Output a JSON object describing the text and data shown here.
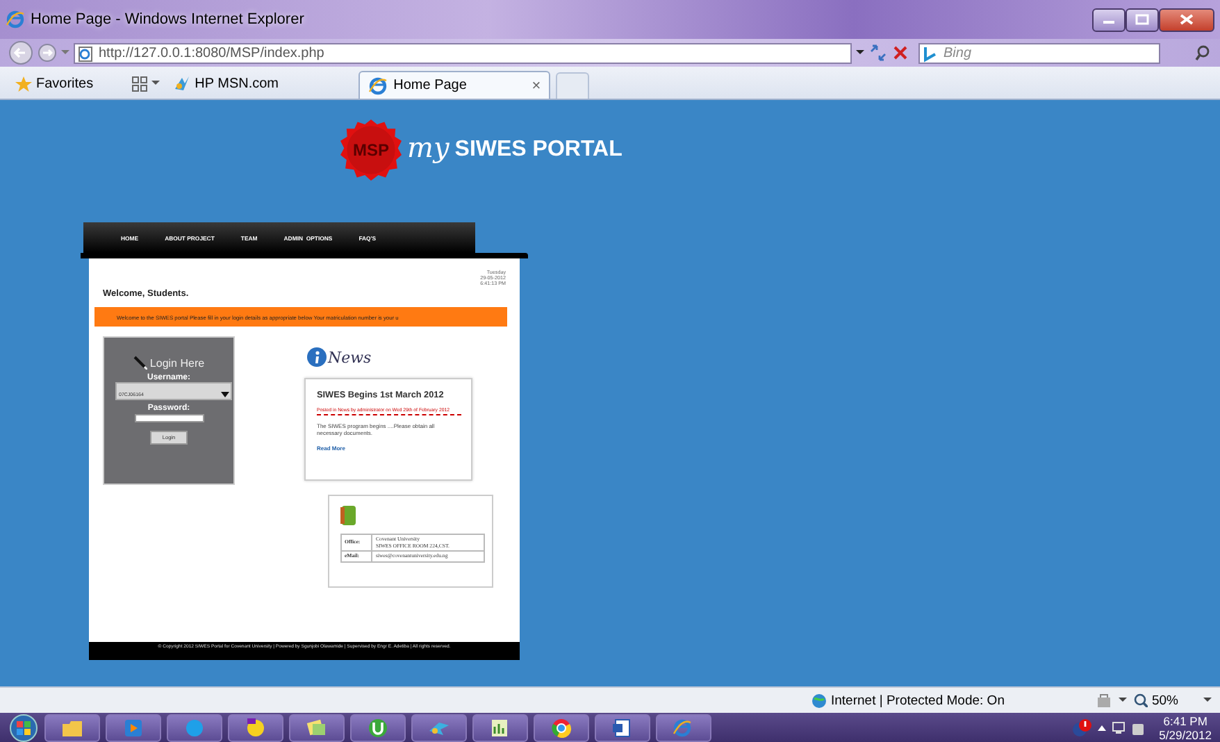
{
  "window": {
    "title": "Home Page - Windows Internet Explorer"
  },
  "address_bar": {
    "url": "http://127.0.0.1:8080/MSP/index.php"
  },
  "search": {
    "placeholder": "Bing"
  },
  "favorites_bar": {
    "favorites": "Favorites",
    "links": [
      "HP MSN.com"
    ]
  },
  "tabs": [
    {
      "label": "Home Page",
      "selected": true,
      "close": "×"
    }
  ],
  "site": {
    "logo_badge": "MSP",
    "logo_script": "my",
    "logo_title": "SIWES PORTAL",
    "nav": [
      "HOME",
      "ABOUT PROJECT",
      "TEAM",
      "ADMIN  OPTIONS",
      "FAQ'S"
    ],
    "date": [
      "Tuesday",
      "29-05-2012",
      "6:41:13 PM"
    ],
    "welcome": "Welcome, Students.",
    "marquee": "Welcome to the SIWES portal Please fill in your login details as appropriate below Your matriculation number is your u",
    "login": {
      "title": "Login Here",
      "username_label": "Username:",
      "username_value": "07CJ06164",
      "password_label": "Password:",
      "button": "Login"
    },
    "news": {
      "heading": "News",
      "title": "SIWES Begins 1st March 2012",
      "meta": "Posted in News by administrator on Wed 29th of February 2012",
      "body": "The SIWES program begins ....Please obtain all necessary documents.",
      "link": "Read More"
    },
    "contact": [
      {
        "label": "Office:",
        "lines": [
          "Covenant University",
          "SIWES OFFICE ROOM 224,CST."
        ]
      },
      {
        "label": "eMail:",
        "lines": [
          "siwes@covenantuniversity.edu.ng"
        ]
      }
    ],
    "footer": "© Copyright 2012  SIWES Portal for Covenant University |  Powered by Sgunjobi Olawamide | Supervised by Engr E. Adetiba |  All rights reserved."
  },
  "status_bar": {
    "zone": "Internet | Protected Mode: On",
    "zoom": "50%"
  },
  "taskbar": {
    "time": "6:41 PM",
    "date": "5/29/2012"
  }
}
